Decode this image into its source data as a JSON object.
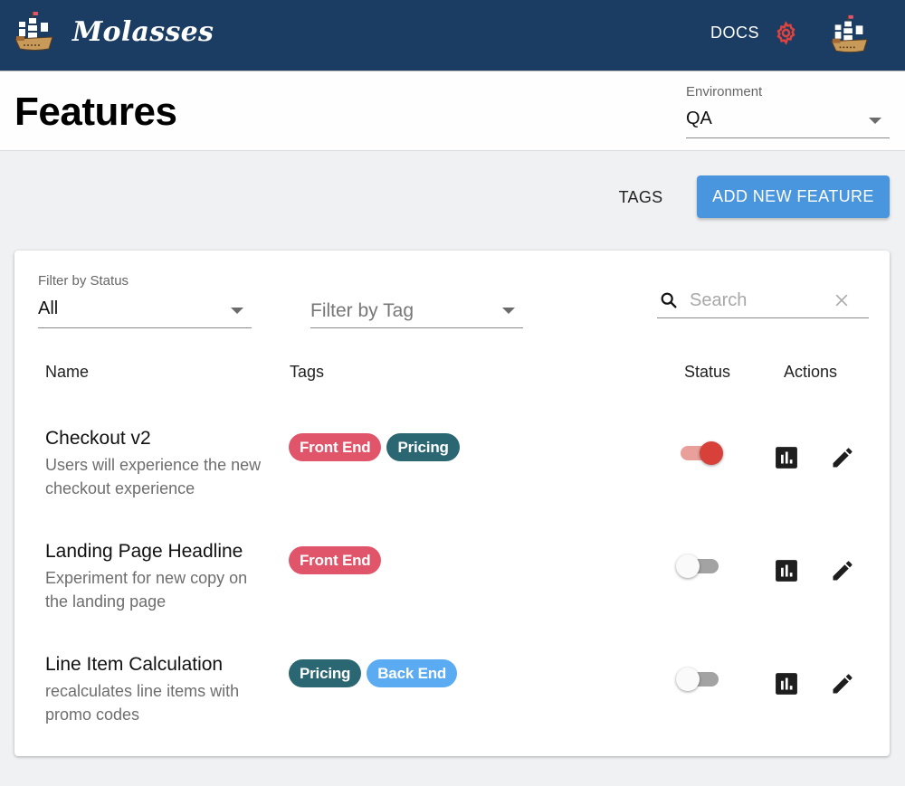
{
  "header": {
    "brand": "Molasses",
    "docs_label": "DOCS",
    "icons": {
      "logo": "ship-icon",
      "settings": "gear-icon",
      "avatar": "ship-icon"
    }
  },
  "page": {
    "title": "Features",
    "environment": {
      "label": "Environment",
      "value": "QA"
    }
  },
  "toolbar": {
    "tags_label": "TAGS",
    "add_label": "ADD NEW FEATURE"
  },
  "filters": {
    "status": {
      "label": "Filter by Status",
      "value": "All"
    },
    "tag": {
      "placeholder": "Filter by Tag"
    },
    "search": {
      "placeholder": "Search",
      "value": ""
    }
  },
  "table": {
    "columns": [
      "Name",
      "Tags",
      "Status",
      "Actions"
    ],
    "rows": [
      {
        "name": "Checkout v2",
        "description": "Users will experience the new checkout experience",
        "tags": [
          {
            "label": "Front End",
            "color": "#e0556a"
          },
          {
            "label": "Pricing",
            "color": "#2b6772"
          }
        ],
        "enabled": true
      },
      {
        "name": "Landing Page Headline",
        "description": "Experiment for new copy on the landing page",
        "tags": [
          {
            "label": "Front End",
            "color": "#e0556a"
          }
        ],
        "enabled": false
      },
      {
        "name": "Line Item Calculation",
        "description": "recalculates line items with promo codes",
        "tags": [
          {
            "label": "Pricing",
            "color": "#2b6772"
          },
          {
            "label": "Back End",
            "color": "#5aabf1"
          }
        ],
        "enabled": false
      }
    ]
  },
  "colors": {
    "topbar": "#1c3d63",
    "primary_button": "#4a96de",
    "toggle_on": "#d8403a",
    "gear": "#e0433e"
  }
}
